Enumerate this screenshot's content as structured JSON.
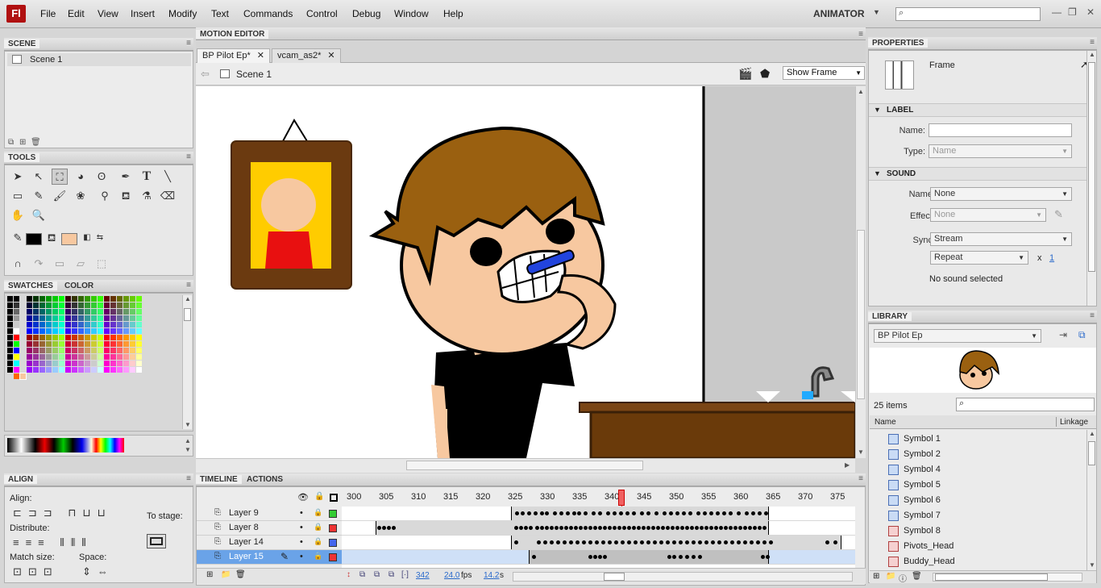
{
  "app": {
    "logo": "Fl",
    "workspace": "ANIMATOR",
    "window_controls": [
      "—",
      "❐",
      "✕"
    ]
  },
  "menu": [
    "File",
    "Edit",
    "View",
    "Insert",
    "Modify",
    "Text",
    "Commands",
    "Control",
    "Debug",
    "Window",
    "Help"
  ],
  "scene_panel": {
    "title": "SCENE",
    "items": [
      "Scene 1"
    ]
  },
  "tools_panel": {
    "title": "TOOLS"
  },
  "swatches_panel": {
    "tabs": [
      "SWATCHES",
      "COLOR"
    ]
  },
  "align_panel": {
    "title": "ALIGN",
    "align": "Align:",
    "distribute": "Distribute:",
    "match_size": "Match size:",
    "space": "Space:",
    "to_stage": "To stage:"
  },
  "motion_editor": {
    "title": "MOTION EDITOR"
  },
  "documents": {
    "tabs": [
      "BP Pilot Ep*",
      "vcam_as2*"
    ],
    "scene": "Scene 1",
    "view_mode": "Show Frame"
  },
  "timeline": {
    "tabs": [
      "TIMELINE",
      "ACTIONS"
    ],
    "frame_numbers": [
      "300",
      "305",
      "310",
      "315",
      "320",
      "325",
      "330",
      "335",
      "340",
      "345",
      "350",
      "355",
      "360",
      "365",
      "370",
      "375"
    ],
    "layers": [
      {
        "name": "Layer 9",
        "color": "#33cc33"
      },
      {
        "name": "Layer 8",
        "color": "#ee3333"
      },
      {
        "name": "Layer 14",
        "color": "#4466ee"
      },
      {
        "name": "Layer 15",
        "color": "#ee3333"
      }
    ],
    "current_frame": "342",
    "fps": "24.0",
    "fps_unit": "fps",
    "time": "14.2",
    "time_unit": "s"
  },
  "properties": {
    "title": "PROPERTIES",
    "type": "Frame",
    "label_section": "LABEL",
    "name_label": "Name:",
    "type_label": "Type:",
    "type_value": "Name",
    "sound_section": "SOUND",
    "sound_name_label": "Name:",
    "sound_name_value": "None",
    "effect_label": "Effect:",
    "effect_value": "None",
    "sync_label": "Sync:",
    "sync_value": "Stream",
    "repeat_value": "Repeat",
    "repeat_x": "x",
    "repeat_count": "1",
    "status": "No sound selected"
  },
  "library": {
    "title": "LIBRARY",
    "document": "BP Pilot Ep",
    "count": "25 items",
    "col_name": "Name",
    "col_linkage": "Linkage",
    "items": [
      "Symbol 1",
      "Symbol 2",
      "Symbol 4",
      "Symbol 5",
      "Symbol 6",
      "Symbol 7",
      "Symbol 8",
      "Pivots_Head",
      "Buddy_Head"
    ]
  }
}
